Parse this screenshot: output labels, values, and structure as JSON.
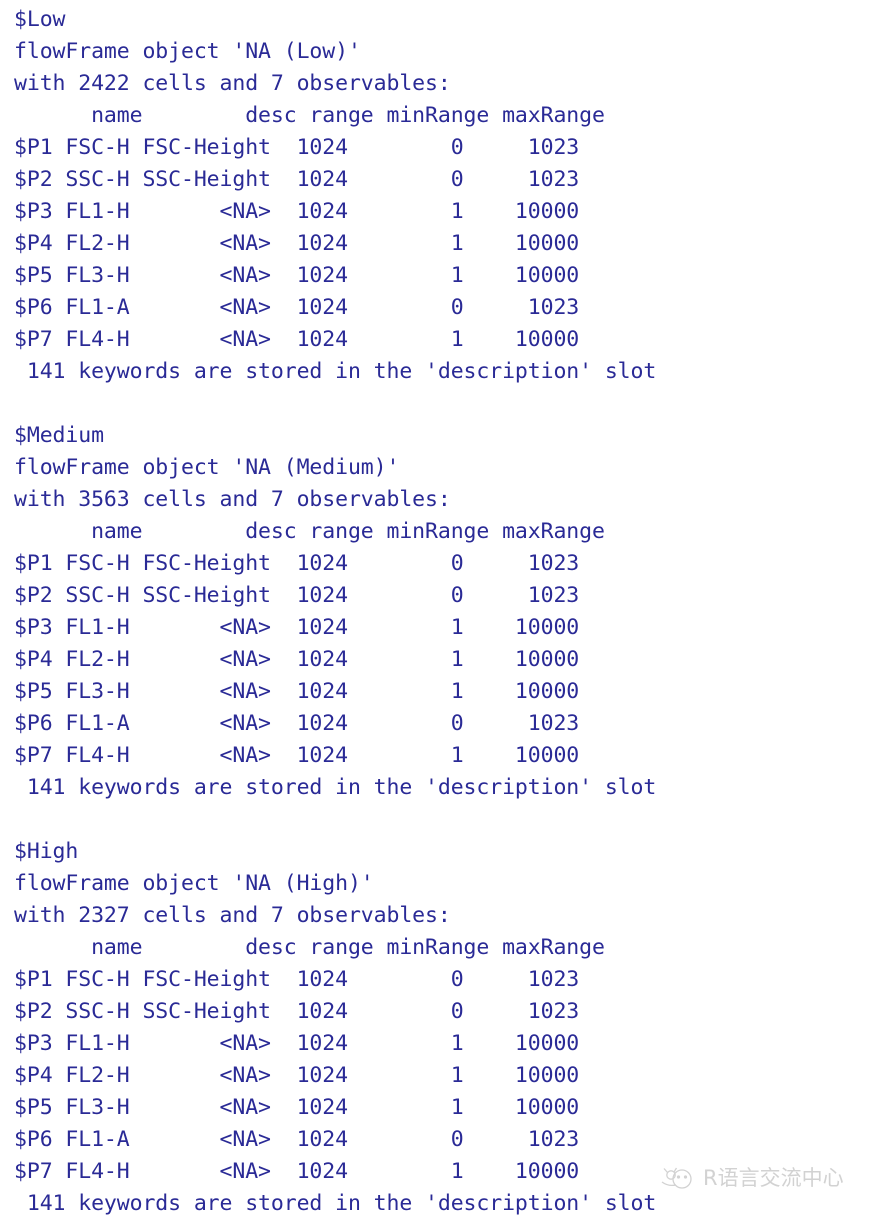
{
  "console": {
    "colors": {
      "text": "#2a2a96",
      "background": "#ffffff",
      "watermark": "#c6c6c6"
    },
    "table_header": "      name        desc range minRange maxRange",
    "keywords_line": " 141 keywords are stored in the 'description' slot",
    "columns": [
      "",
      "name",
      "desc",
      "range",
      "minRange",
      "maxRange"
    ],
    "sections": [
      {
        "name_label": "$Low",
        "object_line": "flowFrame object 'NA (Low)'",
        "summary_line": "with 2422 cells and 7 observables:",
        "object_name": "NA (Low)",
        "cells": 2422,
        "observables": 7,
        "keywords": 141,
        "rows": [
          "$P1 FSC-H FSC-Height  1024        0     1023",
          "$P2 SSC-H SSC-Height  1024        0     1023",
          "$P3 FL1-H       <NA>  1024        1    10000",
          "$P4 FL2-H       <NA>  1024        1    10000",
          "$P5 FL3-H       <NA>  1024        1    10000",
          "$P6 FL1-A       <NA>  1024        0     1023",
          "$P7 FL4-H       <NA>  1024        1    10000"
        ],
        "row_data": [
          {
            "key": "$P1",
            "name": "FSC-H",
            "desc": "FSC-Height",
            "range": "1024",
            "minRange": "0",
            "maxRange": "1023"
          },
          {
            "key": "$P2",
            "name": "SSC-H",
            "desc": "SSC-Height",
            "range": "1024",
            "minRange": "0",
            "maxRange": "1023"
          },
          {
            "key": "$P3",
            "name": "FL1-H",
            "desc": "<NA>",
            "range": "1024",
            "minRange": "1",
            "maxRange": "10000"
          },
          {
            "key": "$P4",
            "name": "FL2-H",
            "desc": "<NA>",
            "range": "1024",
            "minRange": "1",
            "maxRange": "10000"
          },
          {
            "key": "$P5",
            "name": "FL3-H",
            "desc": "<NA>",
            "range": "1024",
            "minRange": "1",
            "maxRange": "10000"
          },
          {
            "key": "$P6",
            "name": "FL1-A",
            "desc": "<NA>",
            "range": "1024",
            "minRange": "0",
            "maxRange": "1023"
          },
          {
            "key": "$P7",
            "name": "FL4-H",
            "desc": "<NA>",
            "range": "1024",
            "minRange": "1",
            "maxRange": "10000"
          }
        ]
      },
      {
        "name_label": "$Medium",
        "object_line": "flowFrame object 'NA (Medium)'",
        "summary_line": "with 3563 cells and 7 observables:",
        "object_name": "NA (Medium)",
        "cells": 3563,
        "observables": 7,
        "keywords": 141,
        "rows": [
          "$P1 FSC-H FSC-Height  1024        0     1023",
          "$P2 SSC-H SSC-Height  1024        0     1023",
          "$P3 FL1-H       <NA>  1024        1    10000",
          "$P4 FL2-H       <NA>  1024        1    10000",
          "$P5 FL3-H       <NA>  1024        1    10000",
          "$P6 FL1-A       <NA>  1024        0     1023",
          "$P7 FL4-H       <NA>  1024        1    10000"
        ],
        "row_data": [
          {
            "key": "$P1",
            "name": "FSC-H",
            "desc": "FSC-Height",
            "range": "1024",
            "minRange": "0",
            "maxRange": "1023"
          },
          {
            "key": "$P2",
            "name": "SSC-H",
            "desc": "SSC-Height",
            "range": "1024",
            "minRange": "0",
            "maxRange": "1023"
          },
          {
            "key": "$P3",
            "name": "FL1-H",
            "desc": "<NA>",
            "range": "1024",
            "minRange": "1",
            "maxRange": "10000"
          },
          {
            "key": "$P4",
            "name": "FL2-H",
            "desc": "<NA>",
            "range": "1024",
            "minRange": "1",
            "maxRange": "10000"
          },
          {
            "key": "$P5",
            "name": "FL3-H",
            "desc": "<NA>",
            "range": "1024",
            "minRange": "1",
            "maxRange": "10000"
          },
          {
            "key": "$P6",
            "name": "FL1-A",
            "desc": "<NA>",
            "range": "1024",
            "minRange": "0",
            "maxRange": "1023"
          },
          {
            "key": "$P7",
            "name": "FL4-H",
            "desc": "<NA>",
            "range": "1024",
            "minRange": "1",
            "maxRange": "10000"
          }
        ]
      },
      {
        "name_label": "$High",
        "object_line": "flowFrame object 'NA (High)'",
        "summary_line": "with 2327 cells and 7 observables:",
        "object_name": "NA (High)",
        "cells": 2327,
        "observables": 7,
        "keywords": 141,
        "rows": [
          "$P1 FSC-H FSC-Height  1024        0     1023",
          "$P2 SSC-H SSC-Height  1024        0     1023",
          "$P3 FL1-H       <NA>  1024        1    10000",
          "$P4 FL2-H       <NA>  1024        1    10000",
          "$P5 FL3-H       <NA>  1024        1    10000",
          "$P6 FL1-A       <NA>  1024        0     1023",
          "$P7 FL4-H       <NA>  1024        1    10000"
        ],
        "row_data": [
          {
            "key": "$P1",
            "name": "FSC-H",
            "desc": "FSC-Height",
            "range": "1024",
            "minRange": "0",
            "maxRange": "1023"
          },
          {
            "key": "$P2",
            "name": "SSC-H",
            "desc": "SSC-Height",
            "range": "1024",
            "minRange": "0",
            "maxRange": "1023"
          },
          {
            "key": "$P3",
            "name": "FL1-H",
            "desc": "<NA>",
            "range": "1024",
            "minRange": "1",
            "maxRange": "10000"
          },
          {
            "key": "$P4",
            "name": "FL2-H",
            "desc": "<NA>",
            "range": "1024",
            "minRange": "1",
            "maxRange": "10000"
          },
          {
            "key": "$P5",
            "name": "FL3-H",
            "desc": "<NA>",
            "range": "1024",
            "minRange": "1",
            "maxRange": "10000"
          },
          {
            "key": "$P6",
            "name": "FL1-A",
            "desc": "<NA>",
            "range": "1024",
            "minRange": "0",
            "maxRange": "1023"
          },
          {
            "key": "$P7",
            "name": "FL4-H",
            "desc": "<NA>",
            "range": "1024",
            "minRange": "1",
            "maxRange": "10000"
          }
        ]
      }
    ]
  },
  "watermark": {
    "text": "R语言交流中心",
    "logo": "mascot-logo-icon"
  }
}
